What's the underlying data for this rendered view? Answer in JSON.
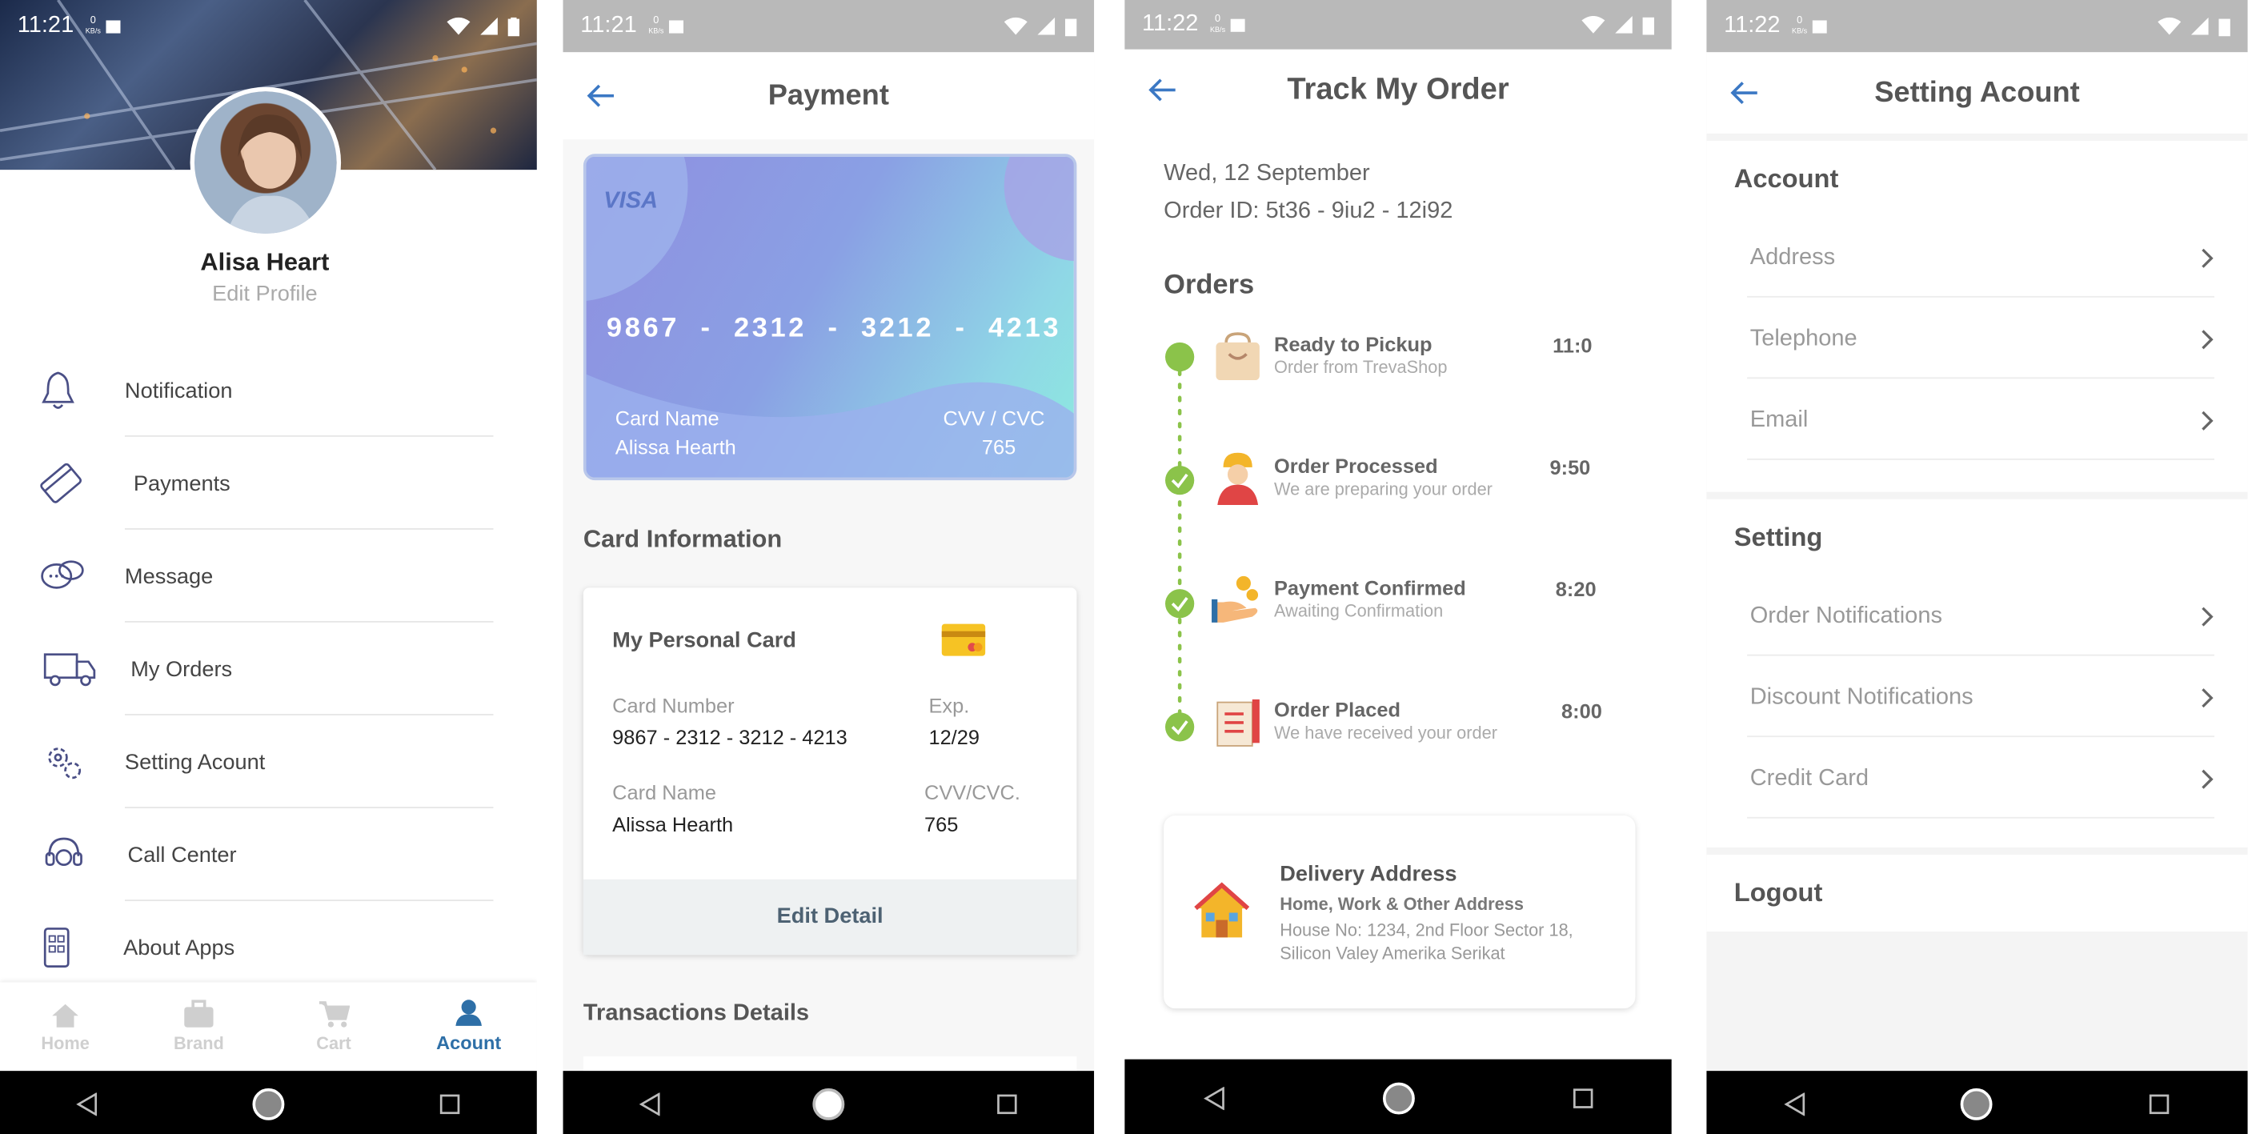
{
  "status": {
    "profile_time": "11:21",
    "payment_time": "11:21",
    "track_time": "11:22",
    "setting_time": "11:22",
    "net_speed": "0",
    "net_unit": "KB/s"
  },
  "profile": {
    "name": "Alisa Heart",
    "edit": "Edit Profile",
    "menu": [
      {
        "label": "Notification",
        "icon": "bell-icon"
      },
      {
        "label": "Payments",
        "icon": "credit-card-icon"
      },
      {
        "label": "Message",
        "icon": "chat-bubbles-icon"
      },
      {
        "label": "My Orders",
        "icon": "delivery-truck-icon"
      },
      {
        "label": "Setting Acount",
        "icon": "gears-icon"
      },
      {
        "label": "Call Center",
        "icon": "headset-icon"
      },
      {
        "label": "About Apps",
        "icon": "phone-apps-icon"
      }
    ],
    "tabs": [
      {
        "label": "Home",
        "icon": "home-icon"
      },
      {
        "label": "Brand",
        "icon": "briefcase-icon"
      },
      {
        "label": "Cart",
        "icon": "cart-icon"
      },
      {
        "label": "Acount",
        "icon": "user-icon"
      }
    ],
    "active_color": "#2e6fa7"
  },
  "payment": {
    "title": "Payment",
    "visa": "VISA",
    "card_number": "9867  -  2312  -  3212  -  4213",
    "card_name_label": "Card Name",
    "card_name": "Alissa Hearth",
    "cvv_label": "CVV / CVC",
    "cvv": "765",
    "info_title": "Card Information",
    "my_card": "My Personal Card",
    "number_label": "Card Number",
    "number": "9867 - 2312 - 3212 - 4213",
    "exp_label": "Exp.",
    "exp": "12/29",
    "name_label": "Card Name",
    "name": "Alissa Hearth",
    "cvv2_label": "CVV/CVC.",
    "cvv2": "765",
    "edit": "Edit Detail",
    "trans": "Transactions Details"
  },
  "track": {
    "title": "Track My Order",
    "date": "Wed, 12 September",
    "order_id": "Order ID: 5t36 - 9iu2 - 12i92",
    "orders": "Orders",
    "steps": [
      {
        "title": "Ready to Pickup",
        "sub": "Order from TrevaShop",
        "time": "11:0",
        "icon": "shopping-bag-icon"
      },
      {
        "title": "Order Processed",
        "sub": "We are preparing your order",
        "time": "9:50",
        "icon": "worker-icon"
      },
      {
        "title": "Payment Confirmed",
        "sub": "Awaiting Confirmation",
        "time": "8:20",
        "icon": "coin-hand-icon"
      },
      {
        "title": "Order Placed",
        "sub": "We have received your order",
        "time": "8:00",
        "icon": "receipt-icon"
      }
    ],
    "delivery_title": "Delivery Address",
    "delivery_sub": "Home, Work & Other Address",
    "delivery_addr1": "House No: 1234, 2nd Floor Sector 18,",
    "delivery_addr2": "Silicon Valey Amerika Serikat",
    "green": "#8bc34a"
  },
  "setting": {
    "title": "Setting Acount",
    "account": "Account",
    "account_items": [
      "Address",
      "Telephone",
      "Email"
    ],
    "setting": "Setting",
    "setting_items": [
      "Order Notifications",
      "Discount Notifications",
      "Credit Card"
    ],
    "logout": "Logout"
  }
}
